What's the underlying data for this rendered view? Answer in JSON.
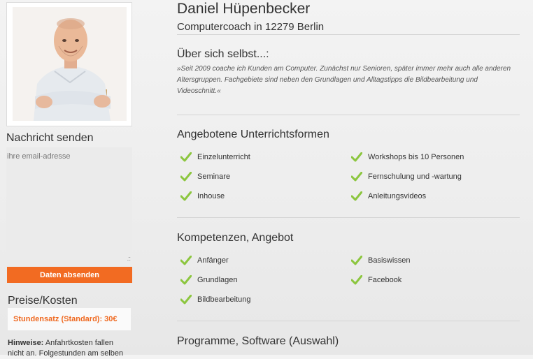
{
  "left": {
    "contact_title": "Nachricht senden",
    "email_placeholder": "ihre email-adresse",
    "submit_label": "Daten absenden",
    "prices_title": "Preise/Kosten",
    "hourly_rate": "Stundensatz (Standard): 30€",
    "notes_label": "Hinweise:",
    "notes_text": "Anfahrtkosten fallen nicht an. Folgestunden am selben"
  },
  "profile": {
    "name": "Daniel Hüpenbecker",
    "subtitle": "Computercoach in 12279 Berlin",
    "about_title": "Über sich selbst...:",
    "about_text": "»Seit 2009 coache ich Kunden am Computer. Zunächst nur Senioren, später immer mehr auch alle anderen Altersgruppen. Fachgebiete sind neben den Grundlagen und Alltagstipps die Bildbearbeitung und Videoschnitt.«"
  },
  "lessons": {
    "title": "Angebotene Unterrichtsformen",
    "items": [
      "Einzelunterricht",
      "Workshops bis 10 Personen",
      "Seminare",
      "Fernschulung und -wartung",
      "Inhouse",
      "Anleitungsvideos"
    ]
  },
  "skills": {
    "title": "Kompetenzen, Angebot",
    "items": [
      "Anfänger",
      "Basiswissen",
      "Grundlagen",
      "Facebook",
      "Bildbearbeitung"
    ]
  },
  "software": {
    "title": "Programme, Software (Auswahl)"
  },
  "colors": {
    "accent": "#f26b22",
    "check": "#8cc63f"
  }
}
